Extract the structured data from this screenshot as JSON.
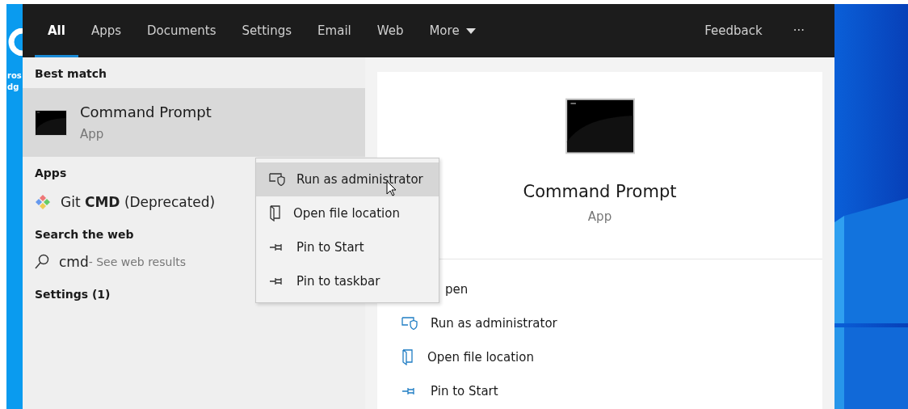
{
  "desktop": {
    "icon_label": [
      "ros",
      "dg"
    ]
  },
  "tabs": [
    {
      "label": "All",
      "selected": true
    },
    {
      "label": "Apps",
      "selected": false
    },
    {
      "label": "Documents",
      "selected": false
    },
    {
      "label": "Settings",
      "selected": false
    },
    {
      "label": "Email",
      "selected": false
    },
    {
      "label": "Web",
      "selected": false
    },
    {
      "label": "More",
      "selected": false,
      "kind": "dropdown"
    }
  ],
  "top_right": {
    "feedback": "Feedback",
    "more": "···"
  },
  "results": {
    "best_match": {
      "heading": "Best match",
      "title": "Command Prompt",
      "subtitle": "App",
      "selected": true
    },
    "apps": {
      "heading": "Apps",
      "items": [
        {
          "label": "Git **CMD** (Deprecated)"
        }
      ]
    },
    "web": {
      "heading": "Search the web",
      "query": "cmd",
      "hint": " - See web results"
    },
    "settings": {
      "heading": "Settings (1)"
    }
  },
  "context_menu": [
    {
      "label": "Run as administrator",
      "kind": "admin",
      "selected": true
    },
    {
      "label": "Open file location",
      "kind": "folder",
      "selected": false
    },
    {
      "label": "Pin to Start",
      "kind": "pin",
      "selected": false
    },
    {
      "label": "Pin to taskbar",
      "kind": "pin",
      "selected": false
    }
  ],
  "preview": {
    "title": "Command Prompt",
    "subtitle": "App",
    "actions": [
      {
        "label": "pen",
        "kind": "covered"
      },
      {
        "label": "Run as administrator",
        "kind": "admin"
      },
      {
        "label": "Open file location",
        "kind": "folder"
      },
      {
        "label": "Pin to Start",
        "kind": "pin"
      }
    ]
  }
}
